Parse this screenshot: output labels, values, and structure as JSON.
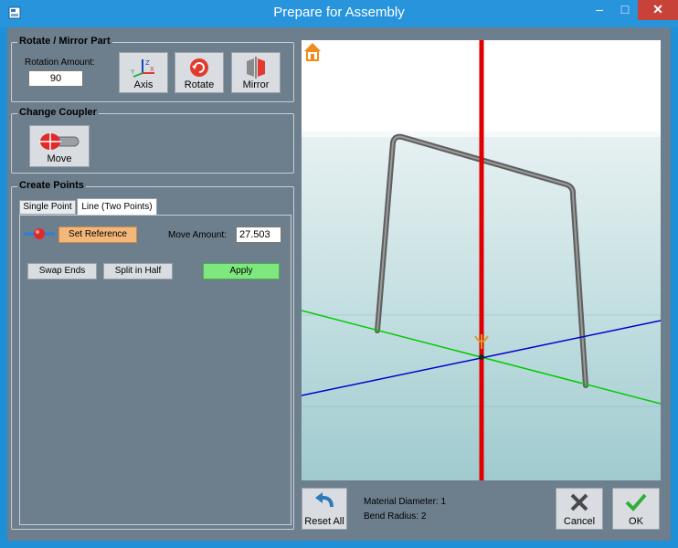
{
  "window": {
    "title": "Prepare for Assembly",
    "min_glyph": "–",
    "max_glyph": "□",
    "close_glyph": "✕"
  },
  "rotate_mirror": {
    "title": "Rotate / Mirror Part",
    "rotation_label": "Rotation Amount:",
    "rotation_value": "90",
    "axis_label": "Axis",
    "rotate_label": "Rotate",
    "mirror_label": "Mirror"
  },
  "change_coupler": {
    "title": "Change Coupler",
    "move_label": "Move"
  },
  "create_points": {
    "title": "Create Points",
    "tabs": [
      {
        "label": "Single Point",
        "active": false
      },
      {
        "label": "Line (Two Points)",
        "active": true
      }
    ],
    "set_reference_label": "Set Reference",
    "move_amount_label": "Move Amount:",
    "move_amount_value": "27.503",
    "swap_ends_label": "Swap Ends",
    "split_half_label": "Split in Half",
    "apply_label": "Apply"
  },
  "bottom": {
    "reset_all_label": "Reset All",
    "material_diameter": "Material Diameter: 1",
    "bend_radius": "Bend Radius: 2",
    "cancel_label": "Cancel",
    "ok_label": "OK"
  },
  "colors": {
    "client_bg": "#6d7e8c",
    "titlebar": "#2794dc",
    "set_reference_bg": "#f4b77a",
    "apply_bg": "#7ee87e",
    "z_axis": "#e00000",
    "y_axis": "#00cc00",
    "x_axis": "#0000cc"
  }
}
